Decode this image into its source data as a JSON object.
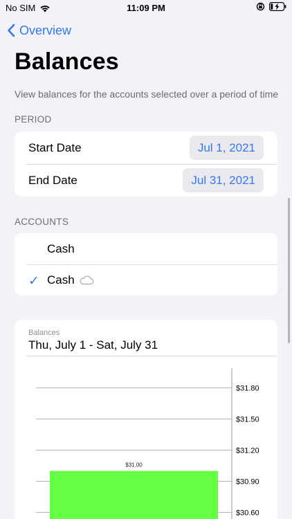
{
  "status_bar": {
    "carrier": "No SIM",
    "time": "11:09 PM"
  },
  "nav": {
    "back_label": "Overview"
  },
  "page": {
    "title": "Balances",
    "description": "View balances for the accounts selected over a period of time"
  },
  "period": {
    "header": "PERIOD",
    "start_label": "Start Date",
    "start_value": "Jul 1, 2021",
    "end_label": "End Date",
    "end_value": "Jul 31, 2021"
  },
  "accounts": {
    "header": "ACCOUNTS",
    "items": [
      {
        "name": "Cash",
        "checked": false,
        "icloud": false
      },
      {
        "name": "Cash",
        "checked": true,
        "icloud": true
      }
    ],
    "check_glyph": "✓"
  },
  "chart": {
    "caption": "Balances",
    "range_label": "Thu, July 1 - Sat, July 31"
  },
  "colors": {
    "accent": "#3478f6",
    "bar": "#66ff44"
  },
  "chart_data": {
    "type": "bar",
    "categories": [
      "Thu, July 1 - Sat, July 31"
    ],
    "values": [
      31.0
    ],
    "data_labels": [
      "$31.00"
    ],
    "y_ticks": [
      "$31.80",
      "$31.50",
      "$31.20",
      "$30.90",
      "$30.60"
    ],
    "y_tick_values": [
      31.8,
      31.5,
      31.2,
      30.9,
      30.6
    ],
    "title": "",
    "xlabel": "",
    "ylabel": "",
    "grid": true,
    "y_axis_side": "right"
  }
}
